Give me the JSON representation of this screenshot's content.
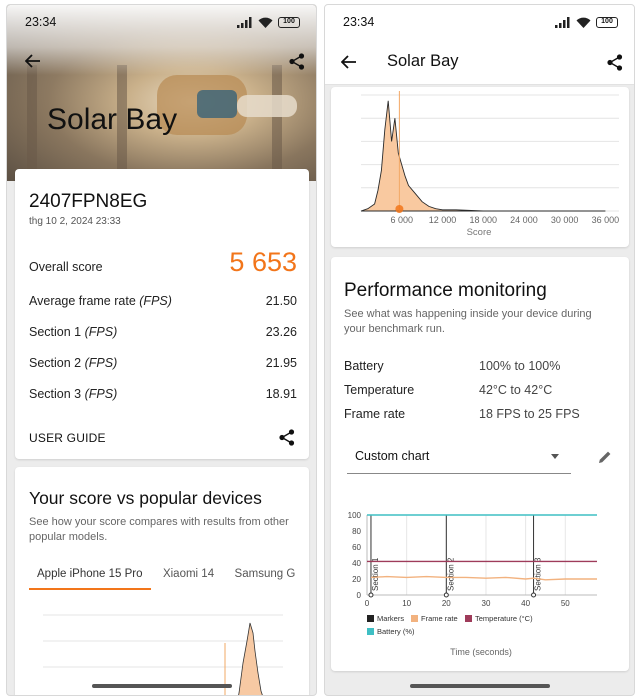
{
  "status": {
    "time": "23:34",
    "battery": "100"
  },
  "left": {
    "hero_title": "Solar Bay",
    "device": {
      "name": "2407FPN8EG",
      "date": "thg 10 2, 2024 23:33"
    },
    "scores": {
      "overall_label": "Overall score",
      "overall_value": "5 653",
      "avg_label": "Average frame rate",
      "avg_unit": "(FPS)",
      "avg_value": "21.50",
      "section1_label": "Section 1",
      "section1_value": "23.26",
      "section2_label": "Section 2",
      "section2_value": "21.95",
      "section3_label": "Section 3",
      "section3_value": "18.91",
      "unit": "(FPS)"
    },
    "user_guide": "USER GUIDE",
    "compare": {
      "title": "Your score vs popular devices",
      "subtitle": "See how your score compares with results from other popular models.",
      "tabs": [
        "Apple iPhone 15 Pro",
        "Xiaomi 14",
        "Samsung G"
      ],
      "active_tab": 0
    }
  },
  "right": {
    "title": "Solar Bay",
    "histogram": {
      "xlabel": "Score",
      "ticks": [
        "6 000",
        "12 000",
        "18 000",
        "24 000",
        "30 000",
        "36 000"
      ]
    },
    "perf": {
      "title": "Performance monitoring",
      "subtitle": "See what was happening inside your device during your benchmark run.",
      "rows": [
        {
          "key": "Battery",
          "value": "100% to 100%"
        },
        {
          "key": "Temperature",
          "value": "42°C to 42°C"
        },
        {
          "key": "Frame rate",
          "value": "18 FPS to 25 FPS"
        }
      ],
      "dropdown": "Custom chart"
    }
  },
  "chart_data": [
    {
      "type": "area",
      "xlabel": "Score",
      "x": [
        0,
        1000,
        2000,
        2500,
        3000,
        3500,
        4000,
        4500,
        5000,
        5500,
        6000,
        6500,
        7000,
        8000,
        9000,
        10000,
        11000,
        12000,
        14000,
        18000,
        24000,
        30000,
        36000
      ],
      "y": [
        0,
        2,
        6,
        18,
        35,
        70,
        95,
        60,
        80,
        50,
        40,
        30,
        22,
        15,
        8,
        4,
        2,
        1,
        1,
        0,
        0,
        0,
        0
      ],
      "xlim": [
        0,
        38000
      ],
      "xticks": [
        6000,
        12000,
        18000,
        24000,
        30000,
        36000
      ],
      "marker_x": 5653,
      "grid": true
    },
    {
      "type": "line",
      "xlabel": "Time (seconds)",
      "xlim": [
        0,
        58
      ],
      "ylim": [
        0,
        100
      ],
      "xticks": [
        0,
        10,
        20,
        30,
        40,
        50
      ],
      "yticks": [
        0,
        20,
        40,
        60,
        80,
        100
      ],
      "markers": [
        {
          "x": 1,
          "label": "Section 1"
        },
        {
          "x": 20,
          "label": "Section 2"
        },
        {
          "x": 42,
          "label": "Section 3"
        }
      ],
      "series": [
        {
          "name": "Battery (%)",
          "color": "#3fbfc4",
          "x": [
            0,
            58
          ],
          "values": [
            100,
            100
          ]
        },
        {
          "name": "Temperature (°C)",
          "color": "#9e3b5a",
          "x": [
            0,
            58
          ],
          "values": [
            42,
            42
          ]
        },
        {
          "name": "Frame rate",
          "color": "#f2b27f",
          "x": [
            1,
            5,
            10,
            15,
            20,
            25,
            30,
            35,
            40,
            42,
            45,
            50,
            55,
            58
          ],
          "values": [
            22,
            23,
            22,
            23,
            22,
            22,
            21,
            22,
            20,
            21,
            19,
            20,
            20,
            20
          ]
        },
        {
          "name": "Markers",
          "color": "#222222",
          "x": [],
          "values": []
        }
      ],
      "legend": [
        "Markers",
        "Frame rate",
        "Temperature (°C)",
        "Battery (%)"
      ]
    }
  ]
}
